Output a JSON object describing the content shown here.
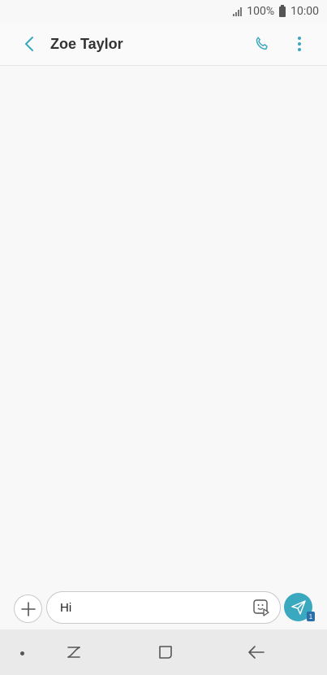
{
  "status": {
    "battery": "100%",
    "time": "10:00"
  },
  "header": {
    "title": "Zoe Taylor"
  },
  "composer": {
    "message_text": "Hi",
    "sim_number": "1"
  },
  "icons": [
    "signal-icon",
    "battery-icon",
    "back-arrow-icon",
    "phone-icon",
    "more-vert-icon",
    "add-icon",
    "sticker-icon",
    "send-icon",
    "recent-apps-icon",
    "home-icon",
    "nav-back-icon"
  ],
  "colors": {
    "accent": "#3aa8be",
    "sim_badge": "#2a6fa8"
  }
}
